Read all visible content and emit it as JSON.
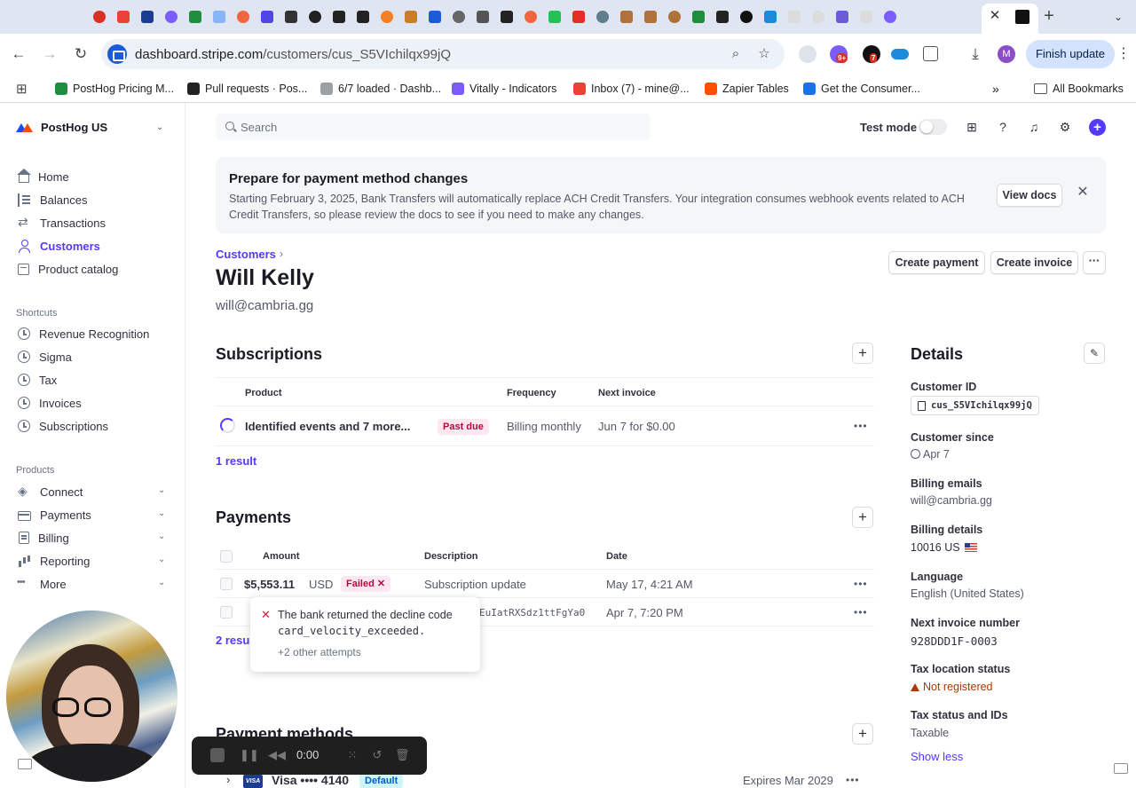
{
  "browser": {
    "tab_favicon_colors": [
      "#d93025",
      "#ea4335",
      "#1a3d91",
      "#7b5cff",
      "#1e8e3e",
      "#8ab4f8",
      "#f1663e",
      "#4f46e5",
      "#333333",
      "#222222",
      "#222222",
      "#222222",
      "#f48024",
      "#c77d2a",
      "#1a5cd7",
      "#666666",
      "#555555",
      "#222222",
      "#f1663e",
      "#21c355",
      "#e52d27",
      "#607d8b",
      "#b0713b",
      "#b0713b",
      "#b0713b",
      "#1e8e3e",
      "#222222",
      "#111111",
      "#1c8adb",
      "#dcdcdc",
      "#dcdcdc",
      "#6b5bd6",
      "#dcdcdc",
      "#7b5cff"
    ],
    "url": {
      "host": "dashboard.stripe.com",
      "path": "/customers/cus_S5VIchilqx99jQ"
    },
    "finish_update": "Finish update",
    "profile_initial": "M",
    "ext_badge_1": "9+",
    "ext_badge_2": "7",
    "bookmarks": [
      {
        "label": "PostHog Pricing M...",
        "color": "#1e8e3e"
      },
      {
        "label": "Pull requests · Pos...",
        "color": "#222222"
      },
      {
        "label": "6/7 loaded · Dashb...",
        "color": "#9aa0a6"
      },
      {
        "label": "Vitally - Indicators",
        "color": "#7b5cff"
      },
      {
        "label": "Inbox (7) - mine@...",
        "color": "#ea4335"
      },
      {
        "label": "Zapier Tables",
        "color": "#ff4f00"
      },
      {
        "label": "Get the Consumer...",
        "color": "#1a73e8"
      }
    ],
    "all_bookmarks": "All Bookmarks"
  },
  "sidebar": {
    "account": "PostHog US",
    "items": [
      {
        "label": "Home",
        "icon": "house"
      },
      {
        "label": "Balances",
        "icon": "bars"
      },
      {
        "label": "Transactions",
        "icon": "arrows"
      },
      {
        "label": "Customers",
        "icon": "person"
      },
      {
        "label": "Product catalog",
        "icon": "box"
      }
    ],
    "shortcuts_label": "Shortcuts",
    "shortcuts": [
      {
        "label": "Revenue Recognition"
      },
      {
        "label": "Sigma"
      },
      {
        "label": "Tax"
      },
      {
        "label": "Invoices"
      },
      {
        "label": "Subscriptions"
      }
    ],
    "products_label": "Products",
    "products": [
      {
        "label": "Connect",
        "icon": "layers"
      },
      {
        "label": "Payments",
        "icon": "card"
      },
      {
        "label": "Billing",
        "icon": "doc"
      },
      {
        "label": "Reporting",
        "icon": "chart"
      },
      {
        "label": "More",
        "icon": "dots"
      }
    ]
  },
  "header": {
    "search_placeholder": "Search",
    "test_mode": "Test mode"
  },
  "banner": {
    "title": "Prepare for payment method changes",
    "text": "Starting February 3, 2025, Bank Transfers will automatically replace ACH Credit Transfers. Your integration consumes webhook events related to ACH Credit Transfers, so please review the docs to see if you need to make any changes.",
    "button": "View docs"
  },
  "customer": {
    "breadcrumb": "Customers",
    "name": "Will Kelly",
    "email": "will@cambria.gg",
    "create_payment": "Create payment",
    "create_invoice": "Create invoice"
  },
  "subscriptions": {
    "title": "Subscriptions",
    "headers": {
      "product": "Product",
      "frequency": "Frequency",
      "next_invoice": "Next invoice"
    },
    "rows": [
      {
        "product": "Identified events and 7 more...",
        "status": "Past due",
        "frequency": "Billing monthly",
        "next_invoice": "Jun 7 for $0.00"
      }
    ],
    "result_count": "1 result"
  },
  "payments": {
    "title": "Payments",
    "headers": {
      "amount": "Amount",
      "description": "Description",
      "date": "Date"
    },
    "rows": [
      {
        "amount": "$5,553.11",
        "currency": "USD",
        "status": "Failed",
        "description": "Subscription update",
        "date": "May 17, 4:21 AM"
      },
      {
        "amount": "",
        "currency": "",
        "status": "",
        "description": "EuIatRXSdz1ttFgYa0",
        "date": "Apr 7, 7:20 PM"
      }
    ],
    "result_count": "2 resu",
    "tooltip": {
      "line1": "The bank returned the decline code",
      "code": "card_velocity_exceeded.",
      "other": "+2 other attempts"
    }
  },
  "payment_methods": {
    "title": "Payment methods",
    "card_brand": "VISA",
    "card": "Visa •••• 4140",
    "default": "Default",
    "expires": "Expires Mar 2029"
  },
  "details": {
    "title": "Details",
    "customer_id_label": "Customer ID",
    "customer_id": "cus_S5VIchilqx99jQ",
    "since_label": "Customer since",
    "since": "Apr 7",
    "billing_emails_label": "Billing emails",
    "billing_emails": "will@cambria.gg",
    "billing_details_label": "Billing details",
    "billing_details": "10016 US",
    "language_label": "Language",
    "language": "English (United States)",
    "next_invoice_number_label": "Next invoice number",
    "next_invoice_number": "928DDD1F-0003",
    "tax_location_label": "Tax location status",
    "tax_location": "Not registered",
    "tax_status_label": "Tax status and IDs",
    "tax_status": "Taxable",
    "show_less": "Show less"
  },
  "recorder": {
    "time": "0:00"
  },
  "colors": {
    "accent": "#533afd",
    "danger": "#b3093c",
    "warning": "#b13600"
  }
}
